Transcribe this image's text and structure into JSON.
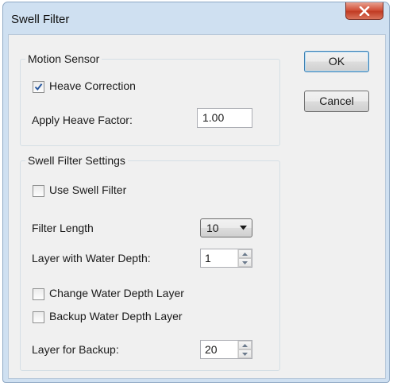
{
  "window": {
    "title": "Swell Filter"
  },
  "buttons": {
    "ok": "OK",
    "cancel": "Cancel"
  },
  "motion_sensor": {
    "group_title": "Motion Sensor",
    "heave_correction": {
      "label": "Heave Correction",
      "checked": true
    },
    "apply_heave_factor": {
      "label": "Apply Heave Factor:",
      "value": "1.00"
    }
  },
  "swell_filter_settings": {
    "group_title": "Swell Filter Settings",
    "use_swell_filter": {
      "label": "Use Swell Filter",
      "checked": false
    },
    "filter_length": {
      "label": "Filter Length",
      "value": "10"
    },
    "layer_with_water_depth": {
      "label": "Layer with Water Depth:",
      "value": "1"
    },
    "change_water_depth_layer": {
      "label": "Change Water Depth Layer",
      "checked": false
    },
    "backup_water_depth_layer": {
      "label": "Backup Water Depth Layer",
      "checked": false
    },
    "layer_for_backup": {
      "label": "Layer for Backup:",
      "value": "20"
    }
  }
}
